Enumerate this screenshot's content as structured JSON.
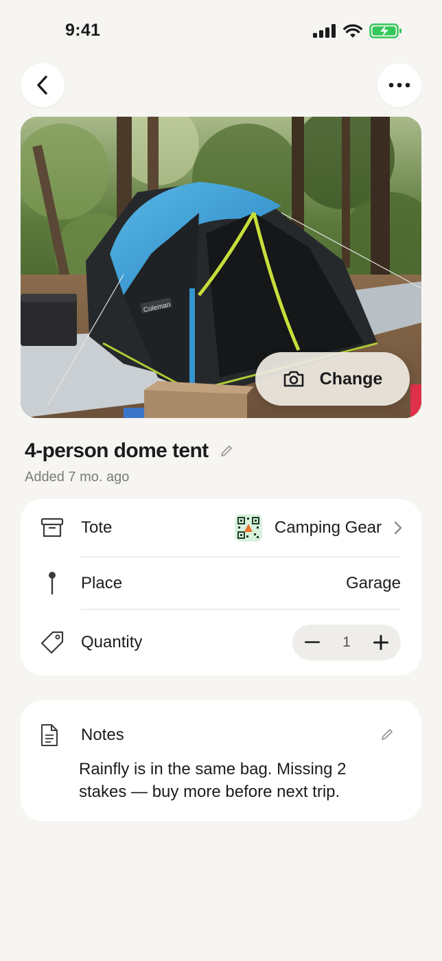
{
  "status_bar": {
    "time": "9:41"
  },
  "nav": {
    "back_icon": "chevron-left-icon",
    "more_icon": "ellipsis-icon"
  },
  "photo": {
    "change_label": "Change",
    "camera_icon": "camera-icon",
    "tent_brand": "Coleman"
  },
  "item": {
    "title": "4-person dome tent",
    "added": "Added 7 mo. ago"
  },
  "details": {
    "tote_label": "Tote",
    "tote_value": "Camping Gear",
    "place_label": "Place",
    "place_value": "Garage",
    "quantity_label": "Quantity",
    "quantity_value": "1"
  },
  "notes": {
    "label": "Notes",
    "text": "Rainfly is in the same bag. Missing 2 stakes — buy more before next trip."
  },
  "colors": {
    "background": "#f6f5f2",
    "card": "#ffffff",
    "battery": "#34c759",
    "tote_badge": "#d9f1dc"
  }
}
